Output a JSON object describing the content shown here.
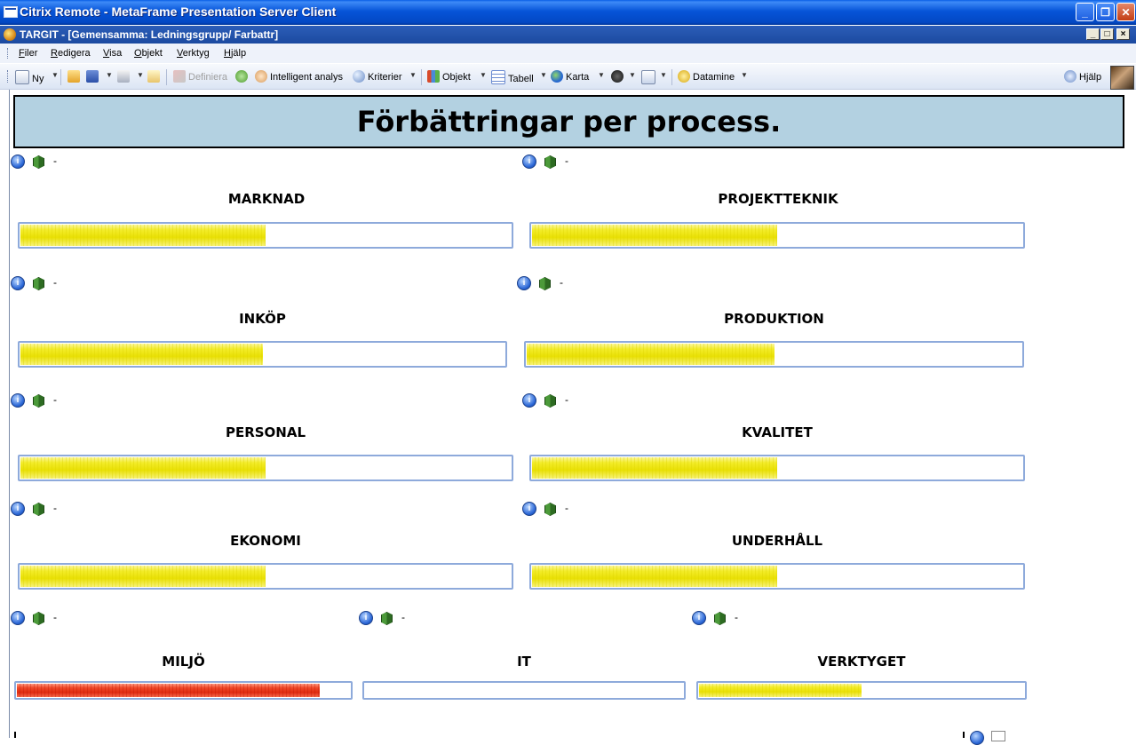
{
  "outer_window": {
    "title": "Citrix Remote - MetaFrame Presentation Server Client"
  },
  "inner_window": {
    "title": "TARGIT - [Gemensamma: Ledningsgrupp/ Farbattr]"
  },
  "menu": [
    "Filer",
    "Redigera",
    "Visa",
    "Objekt",
    "Verktyg",
    "Hjälp"
  ],
  "toolbar": {
    "ny": "Ny",
    "definiera": "Definiera",
    "intelligent_analys": "Intelligent analys",
    "kriterier": "Kriterier",
    "objekt": "Objekt",
    "tabell": "Tabell",
    "karta": "Karta",
    "datamine": "Datamine",
    "hjalp": "Hjälp"
  },
  "report": {
    "title": "Förbättringar per process.",
    "dash": "-",
    "processes": [
      {
        "name": "MARKNAD",
        "progress": 0.5,
        "color": "#f0e800"
      },
      {
        "name": "PROJEKTTEKNIK",
        "progress": 0.5,
        "color": "#f0e800"
      },
      {
        "name": "INKÖP",
        "progress": 0.5,
        "color": "#f0e800"
      },
      {
        "name": "PRODUKTION",
        "progress": 0.5,
        "color": "#f0e800"
      },
      {
        "name": "PERSONAL",
        "progress": 0.5,
        "color": "#f0e800"
      },
      {
        "name": "KVALITET",
        "progress": 0.5,
        "color": "#f0e800"
      },
      {
        "name": "EKONOMI",
        "progress": 0.5,
        "color": "#f0e800"
      },
      {
        "name": "UNDERHÅLL",
        "progress": 0.5,
        "color": "#f0e800"
      },
      {
        "name": "MILJÖ",
        "progress": 0.91,
        "color": "#e83018"
      },
      {
        "name": "IT",
        "progress": 0.0,
        "color": "#f0e800"
      },
      {
        "name": "VERKTYGET",
        "progress": 0.5,
        "color": "#f0e800"
      }
    ]
  }
}
